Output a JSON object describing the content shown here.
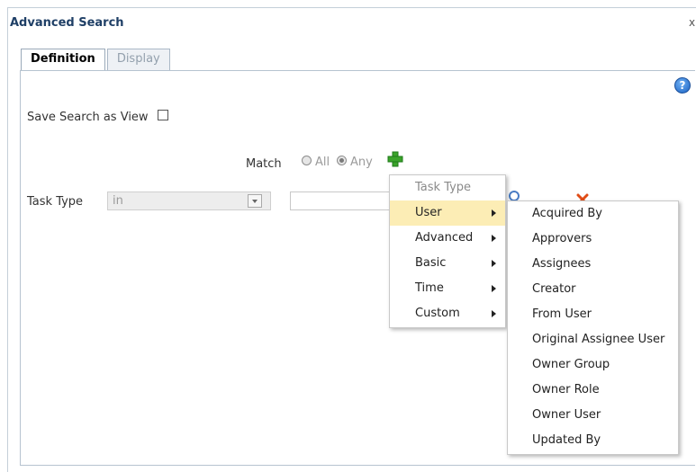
{
  "dialog": {
    "title": "Advanced Search",
    "close": "x"
  },
  "tabs": [
    {
      "label": "Definition"
    },
    {
      "label": "Display"
    }
  ],
  "help": {
    "label": "?"
  },
  "form": {
    "save_view_label": "Save Search as View",
    "match_label": "Match",
    "match_all": "All",
    "match_any": "Any",
    "match_selected": "Any",
    "field_label": "Task Type",
    "operator_value": "in"
  },
  "menu": {
    "header": "Task Type",
    "items": [
      {
        "label": "User"
      },
      {
        "label": "Advanced"
      },
      {
        "label": "Basic"
      },
      {
        "label": "Time"
      },
      {
        "label": "Custom"
      }
    ],
    "highlighted": "User"
  },
  "submenu": {
    "items": [
      {
        "label": "Acquired By"
      },
      {
        "label": "Approvers"
      },
      {
        "label": "Assignees"
      },
      {
        "label": "Creator"
      },
      {
        "label": "From User"
      },
      {
        "label": "Original Assignee User"
      },
      {
        "label": "Owner Group"
      },
      {
        "label": "Owner Role"
      },
      {
        "label": "Owner User"
      },
      {
        "label": "Updated By"
      }
    ]
  },
  "colors": {
    "title": "#1f3f66",
    "highlight": "#fcedb5",
    "add_icon": "#3aa32a",
    "remove_icon": "#e04c16"
  },
  "icons": {
    "add": "plus-icon",
    "remove": "remove-icon",
    "search": "search-icon",
    "help": "help-icon",
    "submenu": "chevron-right-icon"
  }
}
